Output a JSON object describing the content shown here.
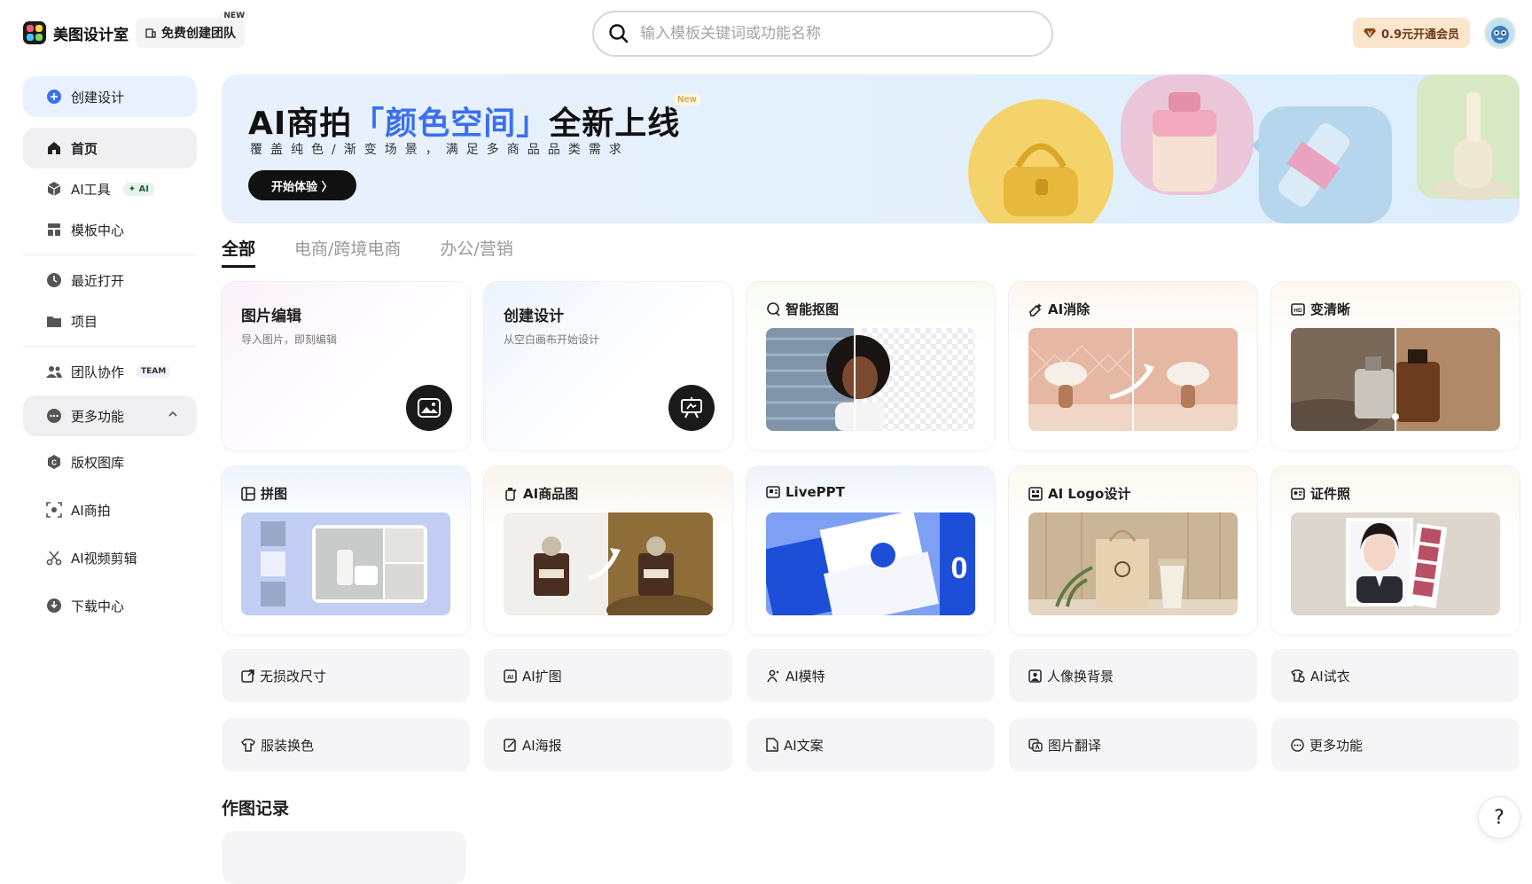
{
  "header": {
    "app_name": "美图设计室",
    "team_button": "免费创建团队",
    "team_new_tag": "NEW",
    "search_placeholder": "输入模板关键词或功能名称",
    "vip_button": "0.9元开通会员"
  },
  "sidebar": {
    "create": "创建设计",
    "items": [
      {
        "label": "首页",
        "icon": "home-icon"
      },
      {
        "label": "AI工具",
        "icon": "cube-icon",
        "badge": "✦ AI"
      },
      {
        "label": "模板中心",
        "icon": "template-icon"
      },
      {
        "label": "最近打开",
        "icon": "clock-icon"
      },
      {
        "label": "项目",
        "icon": "folder-icon"
      },
      {
        "label": "团队协作",
        "icon": "team-icon",
        "badge": "TEAM"
      },
      {
        "label": "更多功能",
        "icon": "more-icon"
      },
      {
        "label": "版权图库",
        "icon": "copyright-icon"
      },
      {
        "label": "AI商拍",
        "icon": "scan-icon"
      },
      {
        "label": "AI视频剪辑",
        "icon": "scissors-icon"
      },
      {
        "label": "下载中心",
        "icon": "download-icon"
      }
    ]
  },
  "banner": {
    "title_a": "AI商拍",
    "title_b": "「颜色空间」",
    "title_c": "全新上线",
    "new_tag": "New",
    "subtitle": "覆盖纯色/渐变场景，满足多商品品类需求",
    "button": "开始体验 〉"
  },
  "tabs": [
    "全部",
    "电商/跨境电商",
    "办公/营销"
  ],
  "cards": [
    {
      "title": "图片编辑",
      "subtitle": "导入图片，即刻编辑"
    },
    {
      "title": "创建设计",
      "subtitle": "从空白画布开始设计"
    },
    {
      "title": "智能抠图"
    },
    {
      "title": "AI消除"
    },
    {
      "title": "变清晰"
    },
    {
      "title": "拼图"
    },
    {
      "title": "AI商品图"
    },
    {
      "title": "LivePPT"
    },
    {
      "title": "AI Logo设计"
    },
    {
      "title": "证件照"
    }
  ],
  "chips": [
    "无损改尺寸",
    "AI扩图",
    "AI模特",
    "人像换背景",
    "AI试衣",
    "服装换色",
    "AI海报",
    "AI文案",
    "图片翻译",
    "更多功能"
  ],
  "section": {
    "history_title": "作图记录"
  },
  "help": "?",
  "colors": {
    "accent": "#3b6ff0",
    "create_bg": "#e8f1fd",
    "vip_bg": "#fbe5cd"
  }
}
